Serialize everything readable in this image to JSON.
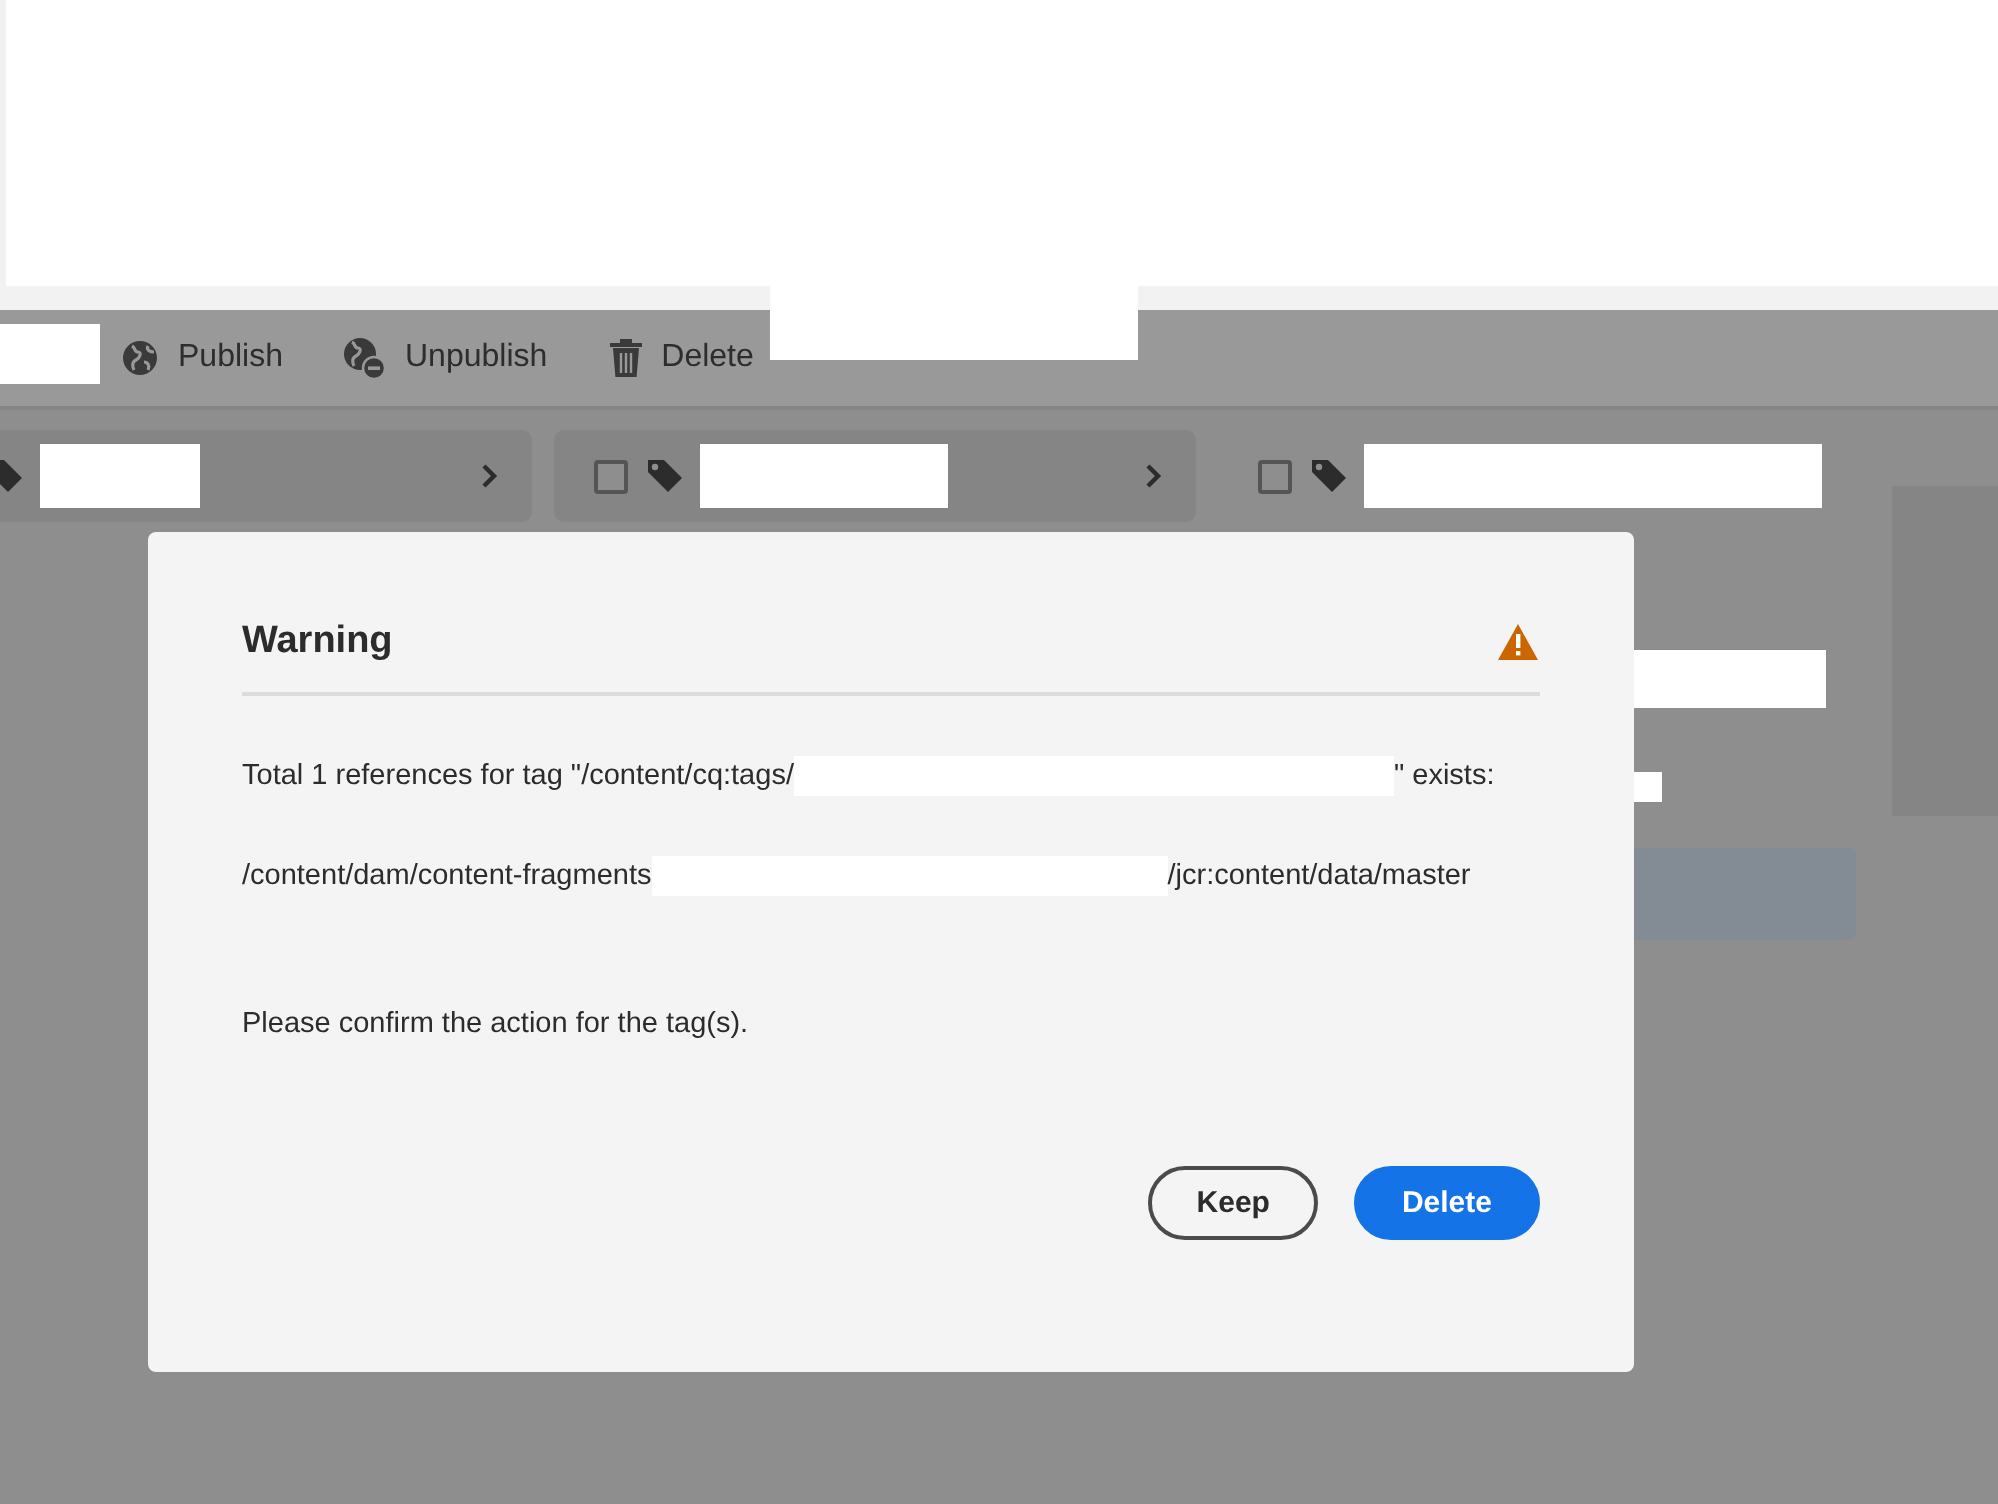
{
  "toolbar": {
    "actions": [
      {
        "label": "Publish",
        "kind": "publish"
      },
      {
        "label": "Unpublish",
        "kind": "unpublish"
      },
      {
        "label": "Delete",
        "kind": "delete"
      }
    ]
  },
  "tags": [
    {
      "kind": "card"
    },
    {
      "kind": "card",
      "checked": false
    },
    {
      "kind": "plain",
      "checked": false
    }
  ],
  "dialog": {
    "title": "Warning",
    "lines": [
      {
        "before": "Total 1 references for tag \"/content/cq:tags/",
        "after": "\" exists:"
      },
      {
        "before": "/content/dam/content-fragments",
        "after": "/jcr:content/data/master"
      }
    ],
    "message": "Please confirm the action for the tag(s).",
    "buttons": [
      {
        "label": "Keep",
        "kind": "secondary"
      },
      {
        "label": "Delete",
        "kind": "primary"
      }
    ]
  }
}
